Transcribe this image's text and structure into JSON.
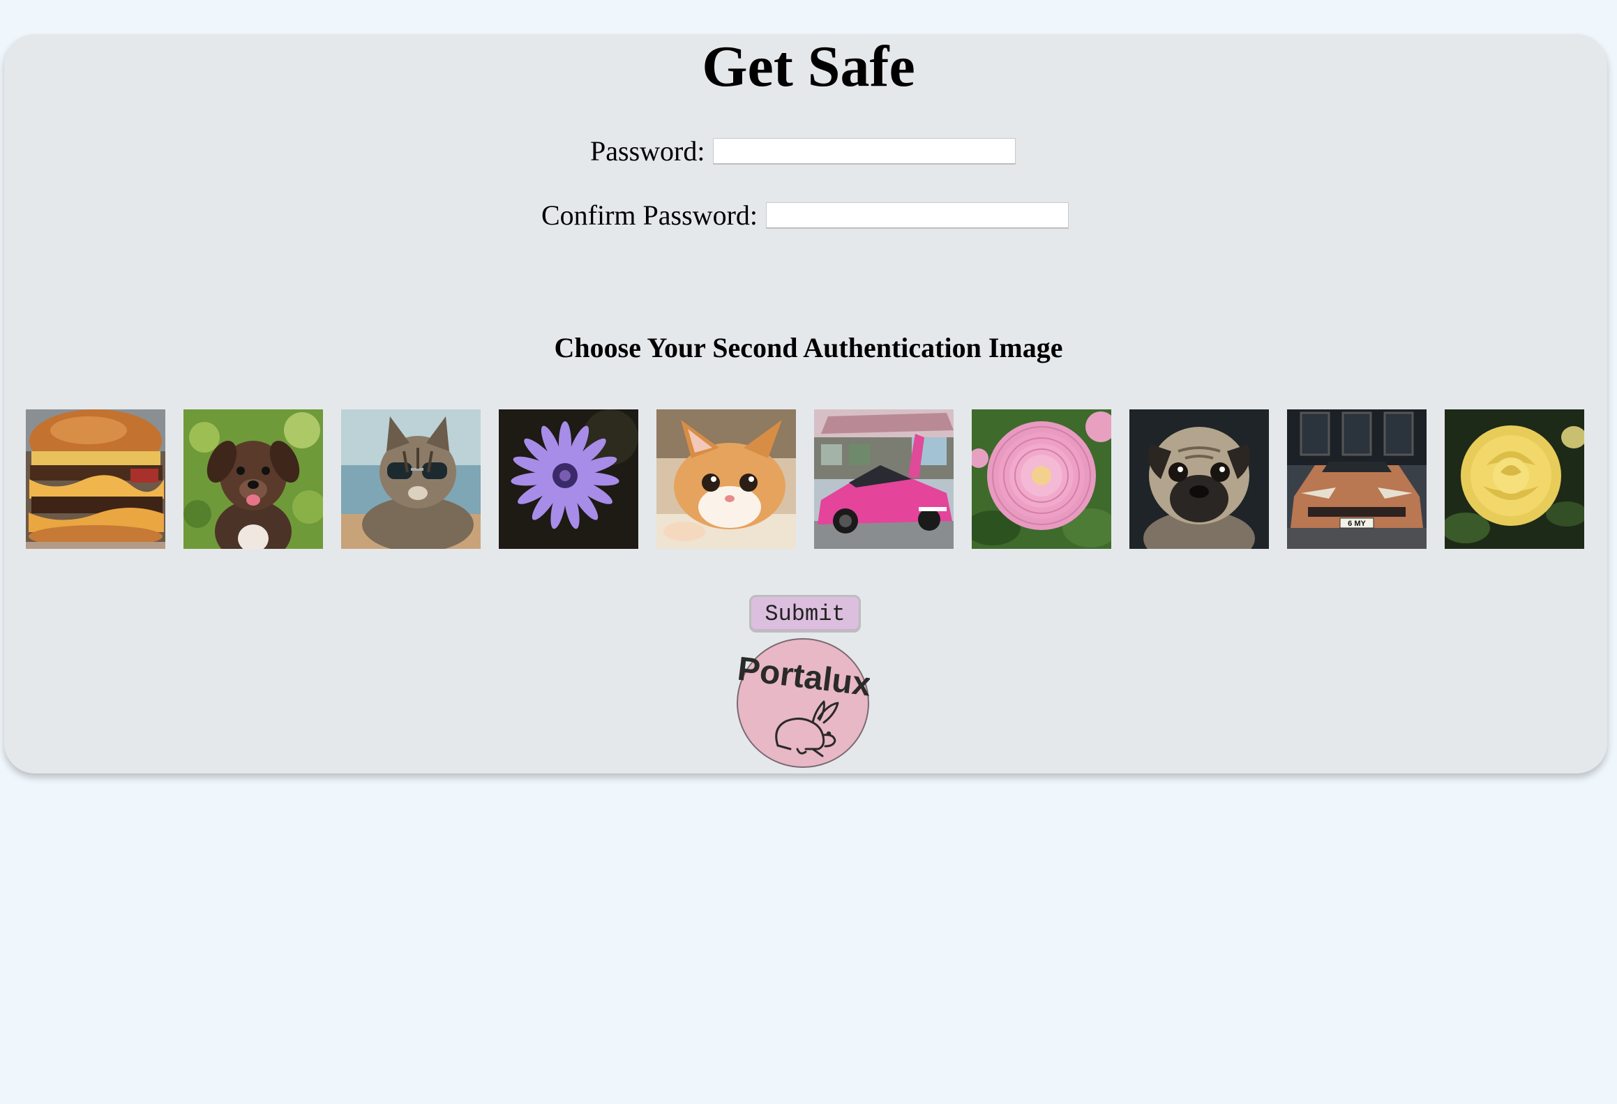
{
  "page": {
    "title": "Get Safe"
  },
  "form": {
    "password_label": "Password:",
    "password_value": "",
    "confirm_label": "Confirm Password:",
    "confirm_value": ""
  },
  "auth_images": {
    "heading": "Choose Your Second Authentication Image",
    "items": [
      {
        "name": "burger-image"
      },
      {
        "name": "puppy-image"
      },
      {
        "name": "cat-sunglasses-image"
      },
      {
        "name": "purple-flower-image"
      },
      {
        "name": "kitten-image"
      },
      {
        "name": "pink-sports-car-image"
      },
      {
        "name": "pink-dahlia-image"
      },
      {
        "name": "pug-image"
      },
      {
        "name": "copper-sports-car-image"
      },
      {
        "name": "yellow-rose-image"
      }
    ],
    "plate_text": "6 MY"
  },
  "actions": {
    "submit_label": "Submit"
  },
  "logo": {
    "text": "Portalux",
    "icon": "rabbit-icon"
  },
  "colors": {
    "page_background": "#eff6fc",
    "card_background": "#e5e8eb",
    "submit_background": "#dcbfdf",
    "logo_background": "#e8b8c6"
  }
}
